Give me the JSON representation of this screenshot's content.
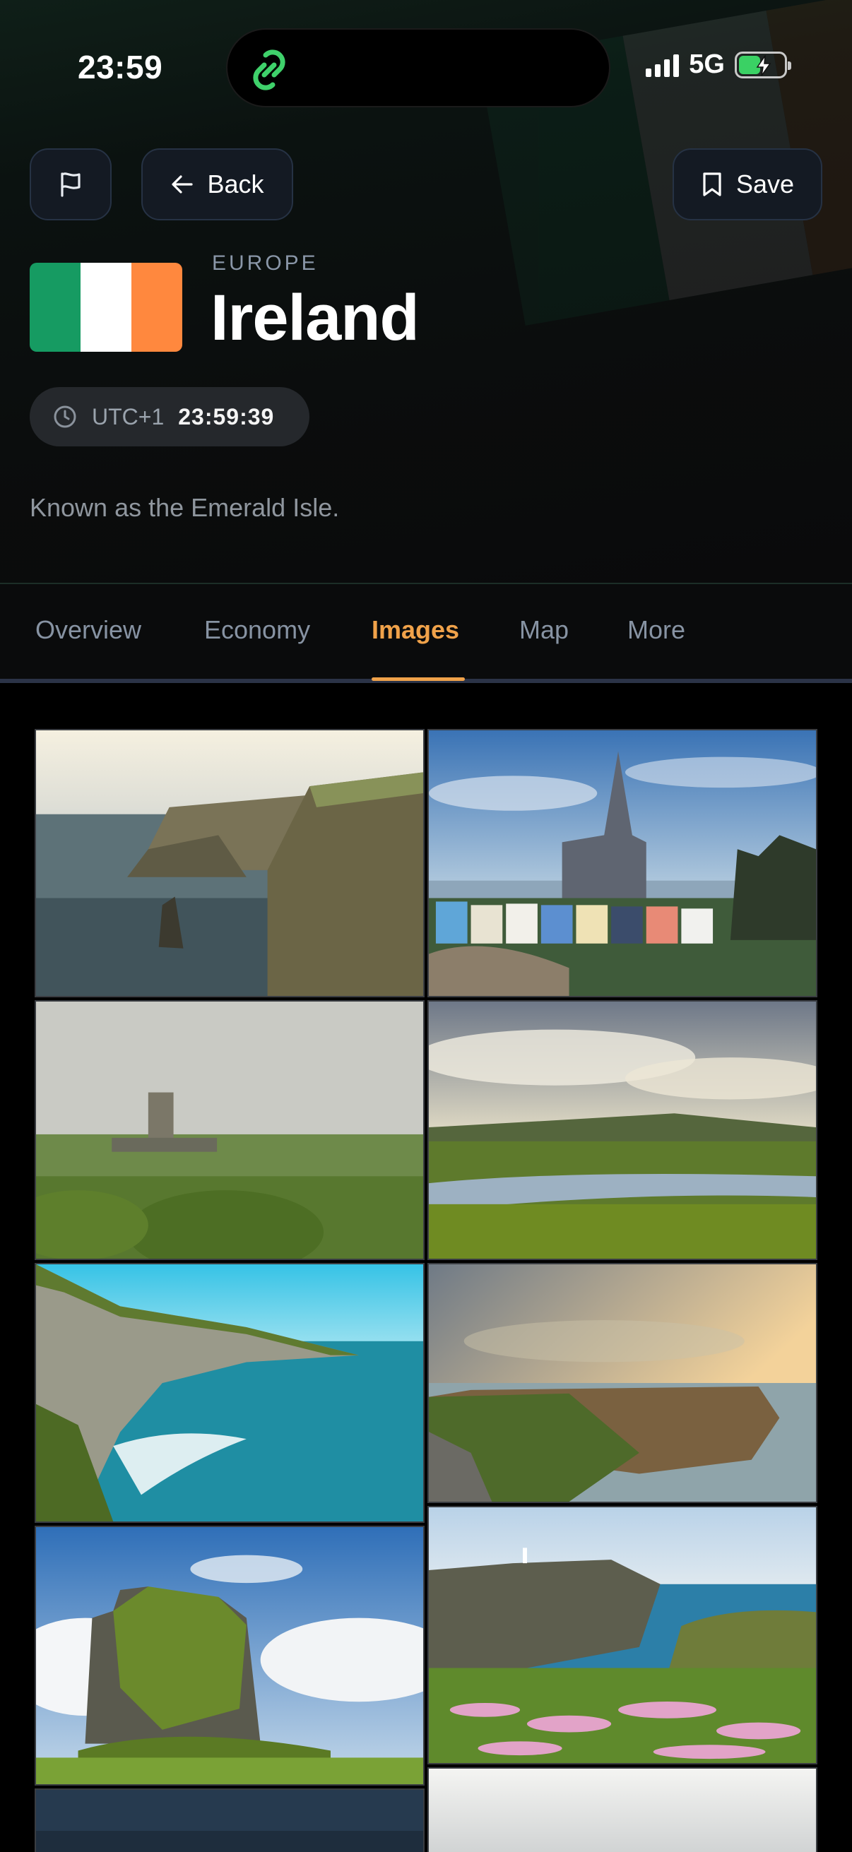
{
  "status_bar": {
    "time": "23:59",
    "network": "5G"
  },
  "header": {
    "back_label": "Back",
    "save_label": "Save",
    "region": "EUROPE",
    "country": "Ireland",
    "timezone": "UTC+1",
    "local_time": "23:59:39",
    "description": "Known as the Emerald Isle."
  },
  "flag_colors": [
    "#169b62",
    "#ffffff",
    "#ff883e"
  ],
  "tabs": [
    {
      "label": "Overview"
    },
    {
      "label": "Economy"
    },
    {
      "label": "Images",
      "active": true
    },
    {
      "label": "Map"
    },
    {
      "label": "More"
    }
  ],
  "accent_color": "#f0a24a",
  "icons": [
    "flag-icon",
    "arrow-left-icon",
    "bookmark-icon",
    "clock-icon"
  ]
}
